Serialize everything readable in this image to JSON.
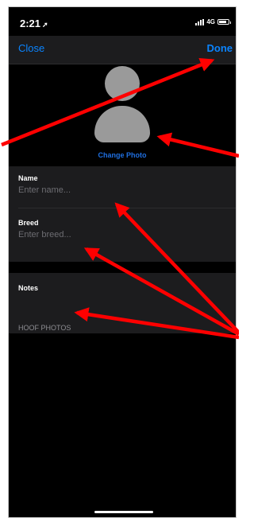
{
  "status_bar": {
    "time": "2:21",
    "location_glyph": "➚",
    "network": "4G",
    "battery_level": 0.85
  },
  "nav": {
    "close_label": "Close",
    "done_label": "Done"
  },
  "avatar": {
    "change_photo_label": "Change Photo"
  },
  "form": {
    "name": {
      "label": "Name",
      "placeholder": "Enter name..."
    },
    "breed": {
      "label": "Breed",
      "placeholder": "Enter breed..."
    },
    "notes": {
      "label": "Notes"
    }
  },
  "sections": {
    "hoof_photos": "HOOF PHOTOS"
  },
  "colors": {
    "accent": "#0a84ff",
    "background": "#000000",
    "field_bg": "#1c1c1e",
    "arrow": "#ff0000"
  }
}
